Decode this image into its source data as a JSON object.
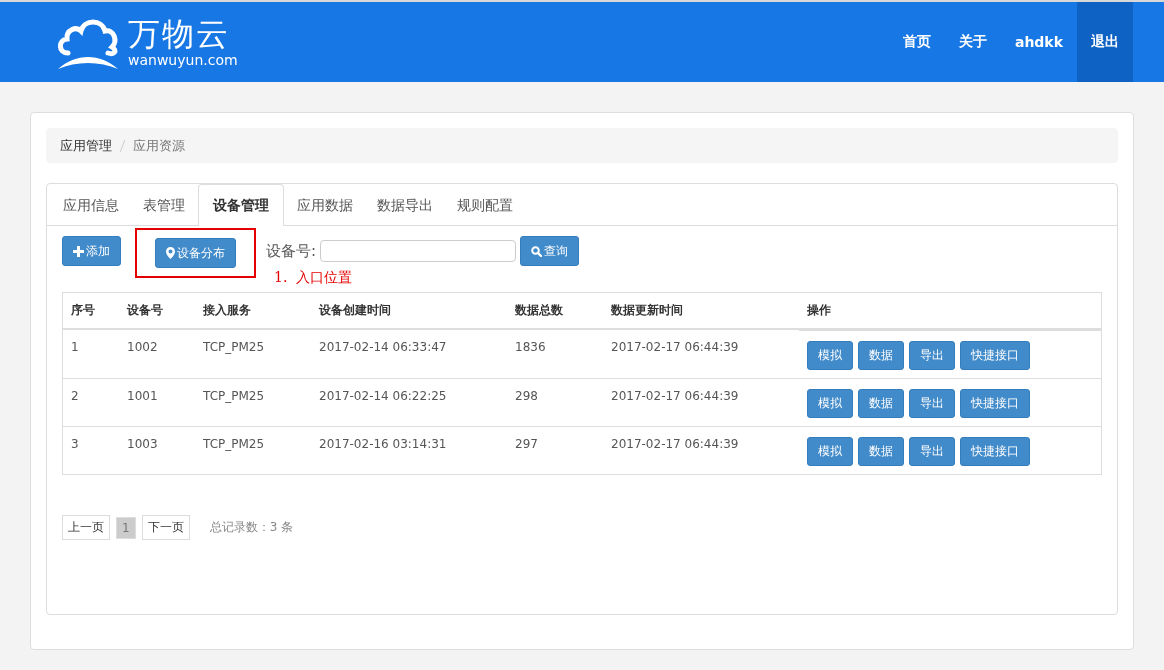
{
  "logo": {
    "name": "万物云",
    "domain": "wanwuyun.com"
  },
  "nav": [
    {
      "label": "首页",
      "selected": false
    },
    {
      "label": "关于",
      "selected": false
    },
    {
      "label": "ahdkk",
      "selected": false
    },
    {
      "label": "退出",
      "selected": true
    }
  ],
  "breadcrumb": [
    "应用管理",
    "应用资源"
  ],
  "tabs": [
    {
      "label": "应用信息",
      "selected": false
    },
    {
      "label": "表管理",
      "selected": false
    },
    {
      "label": "设备管理",
      "selected": true
    },
    {
      "label": "应用数据",
      "selected": false
    },
    {
      "label": "数据导出",
      "selected": false
    },
    {
      "label": "规则配置",
      "selected": false
    }
  ],
  "toolbar": {
    "add_button": "添加",
    "map_button": "设备分布",
    "search_label": "设备号:",
    "query_button": "查询"
  },
  "annotation": {
    "text": "1.  入口位置"
  },
  "table": {
    "columns": [
      "序号",
      "设备号",
      "接入服务",
      "设备创建时间",
      "数据总数",
      "数据更新时间",
      "操作"
    ],
    "rows": [
      {
        "cells": [
          "1",
          "1002",
          "TCP_PM25",
          "2017-02-14 06:33:47",
          "1836",
          "2017-02-17 06:44:39"
        ],
        "actions": [
          "模拟",
          "数据",
          "导出",
          "快捷接口"
        ]
      },
      {
        "cells": [
          "2",
          "1001",
          "TCP_PM25",
          "2017-02-14 06:22:25",
          "298",
          "2017-02-17 06:44:39"
        ],
        "actions": [
          "模拟",
          "数据",
          "导出",
          "快捷接口"
        ]
      },
      {
        "cells": [
          "3",
          "1003",
          "TCP_PM25",
          "2017-02-16 03:14:31",
          "297",
          "2017-02-17 06:44:39"
        ],
        "actions": [
          "模拟",
          "数据",
          "导出",
          "快捷接口"
        ]
      }
    ]
  },
  "pagination": {
    "prev": "上一页",
    "pages": [
      {
        "label": "1",
        "selected": true
      }
    ],
    "next": "下一页",
    "total": "总记录数：3 条"
  }
}
